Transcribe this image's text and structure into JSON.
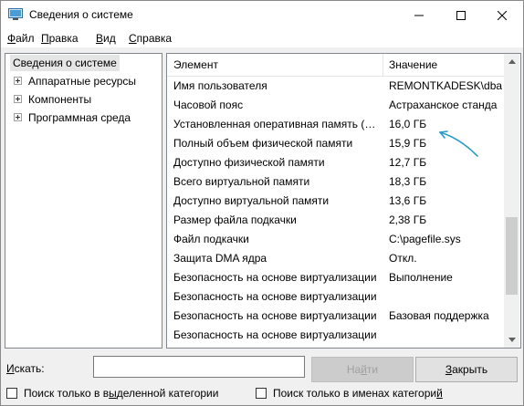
{
  "window": {
    "title": "Сведения о системе",
    "icon": "system-info-icon"
  },
  "menu": [
    {
      "label": "Файл",
      "accel": "Ф",
      "rest": "айл"
    },
    {
      "label": "Правка",
      "accel": "П",
      "rest": "равка"
    },
    {
      "label": "Вид",
      "accel": "В",
      "rest": "ид"
    },
    {
      "label": "Справка",
      "accel": "С",
      "rest": "правка"
    }
  ],
  "tree": {
    "selected": "Сведения о системе",
    "items": [
      {
        "label": "Аппаратные ресурсы"
      },
      {
        "label": "Компоненты"
      },
      {
        "label": "Программная среда"
      }
    ]
  },
  "list": {
    "columns": {
      "element": "Элемент",
      "value": "Значение"
    },
    "rows": [
      {
        "element": "Имя пользователя",
        "value": "REMONTKADESK\\dba"
      },
      {
        "element": "Часовой пояс",
        "value": "Астраханское станда"
      },
      {
        "element": "Установленная оперативная память (RAM)",
        "value": "16,0 ГБ"
      },
      {
        "element": "Полный объем физической памяти",
        "value": "15,9 ГБ"
      },
      {
        "element": "Доступно физической памяти",
        "value": "12,7 ГБ"
      },
      {
        "element": "Всего виртуальной памяти",
        "value": "18,3 ГБ"
      },
      {
        "element": "Доступно виртуальной памяти",
        "value": "13,6 ГБ"
      },
      {
        "element": "Размер файла подкачки",
        "value": "2,38 ГБ"
      },
      {
        "element": "Файл подкачки",
        "value": "C:\\pagefile.sys"
      },
      {
        "element": "Защита DMA ядра",
        "value": "Откл."
      },
      {
        "element": "Безопасность на основе виртуализации",
        "value": "Выполнение"
      },
      {
        "element": "Безопасность на основе виртуализации",
        "value": ""
      },
      {
        "element": "Безопасность на основе виртуализации",
        "value": "Базовая поддержка"
      },
      {
        "element": "Безопасность на основе виртуализации",
        "value": ""
      }
    ]
  },
  "search": {
    "label_accel": "И",
    "label_rest": "скать:",
    "value": ""
  },
  "buttons": {
    "find_pre": "На",
    "find_accel": "й",
    "find_post": "ти",
    "close_accel": "З",
    "close_rest": "акрыть"
  },
  "checks": {
    "selected_pre": "Поиск только в в",
    "selected_accel": "ы",
    "selected_post": "деленной категории",
    "names_pre": "Поиск только в именах категори",
    "names_accel": "й",
    "names_post": ""
  },
  "colors": {
    "annotation_arrow": "#2a9bc4",
    "selection": "#e5e5e5"
  }
}
